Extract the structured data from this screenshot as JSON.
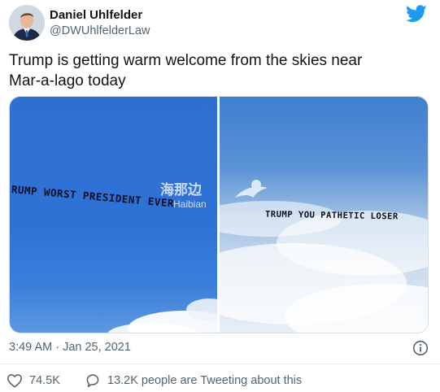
{
  "tweet": {
    "author_name": "Daniel Uhlfelder",
    "author_handle": "@DWUhlfelderLaw",
    "text_line1": "Trump is getting warm welcome from the skies near",
    "text_line2": "Mar-a-lago today",
    "timestamp": "3:49 AM · Jan 25, 2021",
    "likes": "74.5K",
    "replies_label": "13.2K people are Tweeting about this"
  },
  "media": {
    "left_banner_text": "RUMP WORST PRESIDENT EVER",
    "right_banner_text": "TRUMP YOU PATHETIC LOSER",
    "watermark_cn": "海那边",
    "watermark_en": "Haibian"
  },
  "icons": {
    "brand": "twitter-bird-icon",
    "info": "info-icon",
    "like": "heart-icon",
    "reply": "speech-bubble-icon"
  },
  "colors": {
    "twitter_blue": "#1d9bf0",
    "secondary_text": "#536471",
    "primary_text": "#0f1419"
  }
}
